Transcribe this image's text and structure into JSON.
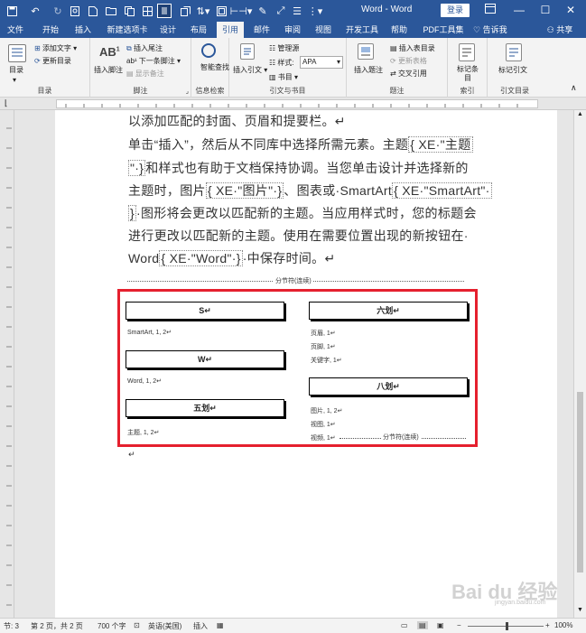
{
  "titlebar": {
    "doc_title": "Word - Word",
    "login_label": "登录"
  },
  "tabs": [
    {
      "label": "文件"
    },
    {
      "label": "开始"
    },
    {
      "label": "插入"
    },
    {
      "label": "新建选项卡"
    },
    {
      "label": "设计"
    },
    {
      "label": "布局"
    },
    {
      "label": "引用"
    },
    {
      "label": "邮件"
    },
    {
      "label": "审阅"
    },
    {
      "label": "视图"
    },
    {
      "label": "开发工具"
    },
    {
      "label": "帮助"
    },
    {
      "label": "PDF工具集"
    },
    {
      "label": "告诉我"
    },
    {
      "label": "共享"
    }
  ],
  "ribbon": {
    "toc": {
      "btn": "目录",
      "add_text": "添加文字",
      "update_toc": "更新目录",
      "group": "目录"
    },
    "footnote": {
      "insert_footnote": "插入脚注",
      "insert_endnote": "插入尾注",
      "next_footnote": "下一条脚注",
      "show_notes": "显示备注",
      "group": "脚注"
    },
    "research": {
      "smart_lookup": "智能查找",
      "group": "信息检索"
    },
    "citations": {
      "insert_citation": "插入引文",
      "manage_sources": "管理源",
      "style_label": "样式:",
      "style_value": "APA",
      "bibliography": "书目",
      "group": "引文与书目"
    },
    "captions": {
      "insert_caption": "插入题注",
      "insert_table_of_figures": "插入表目录",
      "update_table": "更新表格",
      "cross_reference": "交叉引用",
      "group": "题注"
    },
    "index": {
      "mark_entry": "标记条目",
      "group": "索引"
    },
    "authorities": {
      "mark_citation": "标记引文",
      "group": "引文目录"
    }
  },
  "document": {
    "line1": "以添加匹配的封面、页眉和提要栏。↵",
    "line2_a": "单击“插入”，然后从不同库中选择所需元素。主题",
    "line2_field": "{ XE·\"主题",
    "line3_field": "\"·}",
    "line3_b": "和样式也有助于文档保持协调。当您单击设计并选择新的",
    "line4_a": "主题时，图片",
    "line4_field1": "{ XE·\"图片\"·}",
    "line4_b": "、图表或·SmartArt",
    "line4_field2": "{ XE·\"SmartArt\"·",
    "line5_field": "}",
    "line5_b": "·图形将会更改以匹配新的主题。当应用样式时，您的标题会",
    "line6": "进行更改以匹配新的主题。使用在需要位置出现的新按钮在·",
    "line7_a": "Word",
    "line7_field": "{ XE·\"Word\"·}",
    "line7_b": "·中保存时间。↵",
    "section_break": "分节符(连续)",
    "index_left": [
      {
        "heading": "S↵",
        "entries": [
          "SmartArt, 1, 2↵"
        ]
      },
      {
        "heading": "W↵",
        "entries": [
          "Word, 1, 2↵"
        ]
      },
      {
        "heading": "五划↵",
        "entries": [
          "主题, 1, 2↵"
        ]
      }
    ],
    "index_right": [
      {
        "heading": "六划↵",
        "entries": [
          "页眉, 1↵",
          "页脚, 1↵",
          "关键字, 1↵"
        ]
      },
      {
        "heading": "八划↵",
        "entries": [
          "图片, 1, 2↵",
          "视图, 1↵",
          "视频, 1↵"
        ]
      }
    ],
    "section_break_inline": "分节符(连续)",
    "cursor_mark": "↵"
  },
  "statusbar": {
    "section": "节: 3",
    "page": "第 2 页，共 2 页",
    "words": "700 个字",
    "language": "英语(美国)",
    "insert_mode": "插入",
    "zoom": "100%"
  },
  "watermark": {
    "text": "Bai du 经验",
    "url": "jingyan.baidu.com"
  },
  "colors": {
    "accent": "#2b579a",
    "highlight_frame": "#e5202e"
  }
}
